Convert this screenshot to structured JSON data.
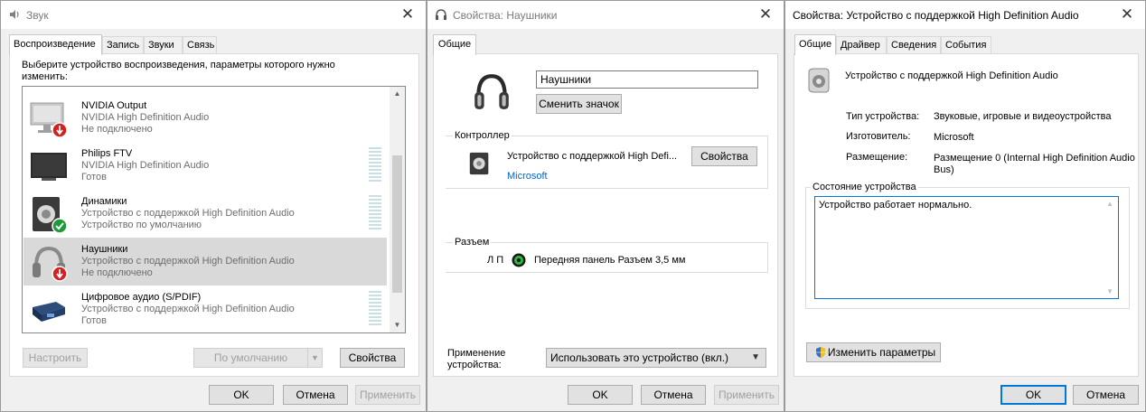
{
  "sound_dialog": {
    "title": "Звук",
    "tabs": [
      "Воспроизведение",
      "Запись",
      "Звуки",
      "Связь"
    ],
    "instruction": "Выберите устройство воспроизведения, параметры которого нужно изменить:",
    "devices": [
      {
        "name": "NVIDIA Output",
        "line1": "NVIDIA High Definition Audio",
        "line2": "Не подключено",
        "icon": "monitor-disconnected-icon",
        "selected": false
      },
      {
        "name": "Philips FTV",
        "line1": "NVIDIA High Definition Audio",
        "line2": "Готов",
        "icon": "tv-icon",
        "selected": false
      },
      {
        "name": "Динамики",
        "line1": "Устройство с поддержкой High Definition Audio",
        "line2": "Устройство по умолчанию",
        "icon": "speaker-default-icon",
        "selected": false
      },
      {
        "name": "Наушники",
        "line1": "Устройство с поддержкой High Definition Audio",
        "line2": "Не подключено",
        "icon": "headphones-disconnected-icon",
        "selected": true
      },
      {
        "name": "Цифровое аудио (S/PDIF)",
        "line1": "Устройство с поддержкой High Definition Audio",
        "line2": "Готов",
        "icon": "spdif-icon",
        "selected": false
      }
    ],
    "configure_label": "Настроить",
    "default_label": "По умолчанию",
    "properties_label": "Свойства",
    "ok_label": "OK",
    "cancel_label": "Отмена",
    "apply_label": "Применить"
  },
  "headphones_dialog": {
    "title": "Свойства: Наушники",
    "tab": "Общие",
    "device_name_value": "Наушники",
    "change_icon_label": "Сменить значок",
    "controller_group": "Контроллер",
    "controller_name": "Устройство с поддержкой High Defi...",
    "controller_properties_label": "Свойства",
    "controller_vendor": "Microsoft",
    "jack_group": "Разъем",
    "jack_channels": "Л П",
    "jack_description": "Передняя панель Разъем 3,5 мм",
    "usage_label": "Применение устройства:",
    "usage_value": "Использовать это устройство (вкл.)",
    "ok_label": "OK",
    "cancel_label": "Отмена",
    "apply_label": "Применить"
  },
  "hda_dialog": {
    "title": "Свойства: Устройство с поддержкой High Definition Audio",
    "tabs": [
      "Общие",
      "Драйвер",
      "Сведения",
      "События"
    ],
    "device_name": "Устройство с поддержкой High Definition Audio",
    "fields": [
      {
        "key": "Тип устройства:",
        "value": "Звуковые, игровые и видеоустройства"
      },
      {
        "key": "Изготовитель:",
        "value": "Microsoft"
      },
      {
        "key": "Размещение:",
        "value": "Размещение 0 (Internal High Definition Audio Bus)"
      }
    ],
    "status_group": "Состояние устройства",
    "status_text": "Устройство работает нормально.",
    "change_settings_label": "Изменить параметры",
    "ok_label": "OK",
    "cancel_label": "Отмена"
  },
  "colors": {
    "accent": "#0078d7",
    "selection": "#d9d9d9",
    "ok_green": "#1e9a3a",
    "disconnect_red": "#d32020"
  }
}
